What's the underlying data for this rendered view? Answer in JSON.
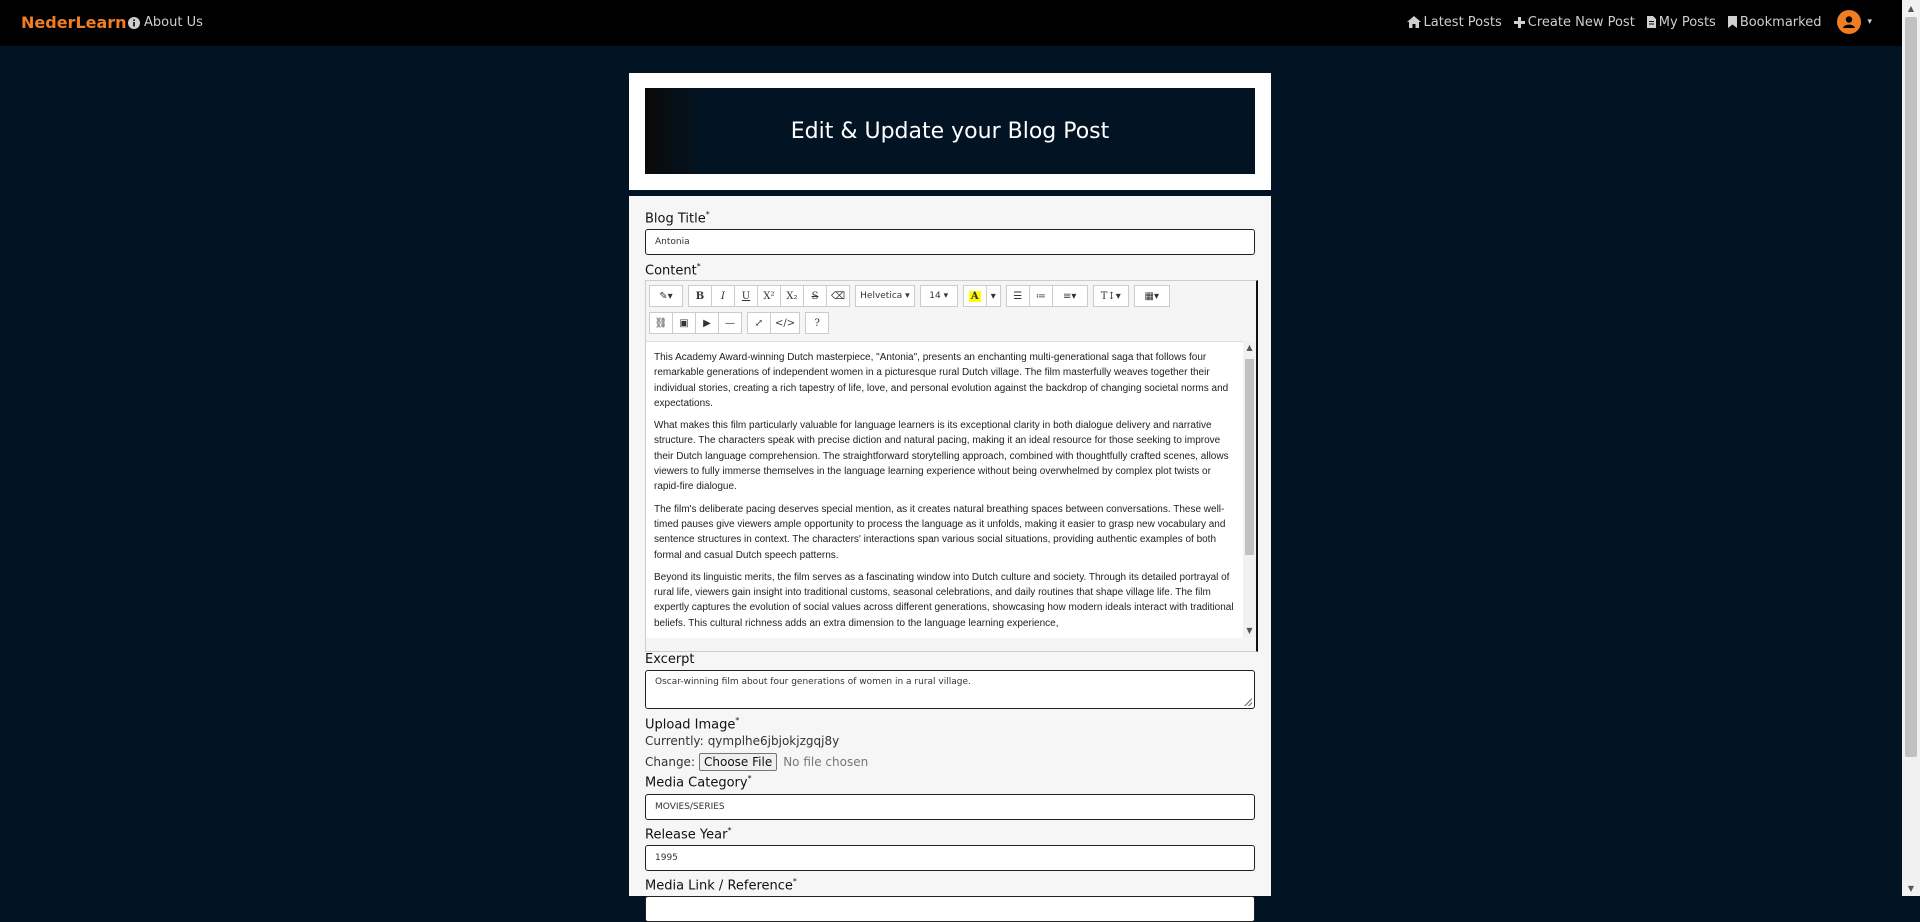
{
  "navbar": {
    "brand": "NederLearn",
    "about": "About Us",
    "links": [
      {
        "label": "Latest Posts",
        "icon": "home-icon"
      },
      {
        "label": "Create New Post",
        "icon": "plus-icon"
      },
      {
        "label": "My Posts",
        "icon": "file-icon"
      },
      {
        "label": "Bookmarked",
        "icon": "bookmark-icon"
      }
    ]
  },
  "header": {
    "title": "Edit & Update your Blog Post"
  },
  "form": {
    "blog_title": {
      "label": "Blog Title",
      "value": "Antonia"
    },
    "content": {
      "label": "Content",
      "toolbar": {
        "font_name": "Helvetica",
        "font_size": "14"
      },
      "paragraphs": [
        "This Academy Award-winning Dutch masterpiece, \"Antonia\", presents an enchanting multi-generational saga that follows four remarkable generations of independent women in a picturesque rural Dutch village. The film masterfully weaves together their individual stories, creating a rich tapestry of life, love, and personal evolution against the backdrop of changing societal norms and expectations.",
        "What makes this film particularly valuable for language learners is its exceptional clarity in both dialogue delivery and narrative structure. The characters speak with precise diction and natural pacing, making it an ideal resource for those seeking to improve their Dutch language comprehension. The straightforward storytelling approach, combined with thoughtfully crafted scenes, allows viewers to fully immerse themselves in the language learning experience without being overwhelmed by complex plot twists or rapid-fire dialogue.",
        "The film's deliberate pacing deserves special mention, as it creates natural breathing spaces between conversations. These well-timed pauses give viewers ample opportunity to process the language as it unfolds, making it easier to grasp new vocabulary and sentence structures in context. The characters' interactions span various social situations, providing authentic examples of both formal and casual Dutch speech patterns.",
        "Beyond its linguistic merits, the film serves as a fascinating window into Dutch culture and society. Through its detailed portrayal of rural life, viewers gain insight into traditional customs, seasonal celebrations, and daily routines that shape village life. The film expertly captures the evolution of social values across different generations, showcasing how modern ideals interact with traditional beliefs. This cultural richness adds an extra dimension to the language learning experience,"
      ]
    },
    "excerpt": {
      "label": "Excerpt",
      "value": "Oscar-winning film about four generations of women in a rural village."
    },
    "upload_image": {
      "label": "Upload Image",
      "currently_label": "Currently:",
      "currently_value": "qymplhe6jbjokjzgqj8y",
      "change_label": "Change:",
      "button_label": "Choose File",
      "no_file": "No file chosen"
    },
    "media_category": {
      "label": "Media Category",
      "value": "MOVIES/SERIES"
    },
    "release_year": {
      "label": "Release Year",
      "value": "1995"
    },
    "media_link": {
      "label": "Media Link / Reference"
    }
  },
  "colors": {
    "brand": "#f07d22",
    "background": "#021424"
  }
}
